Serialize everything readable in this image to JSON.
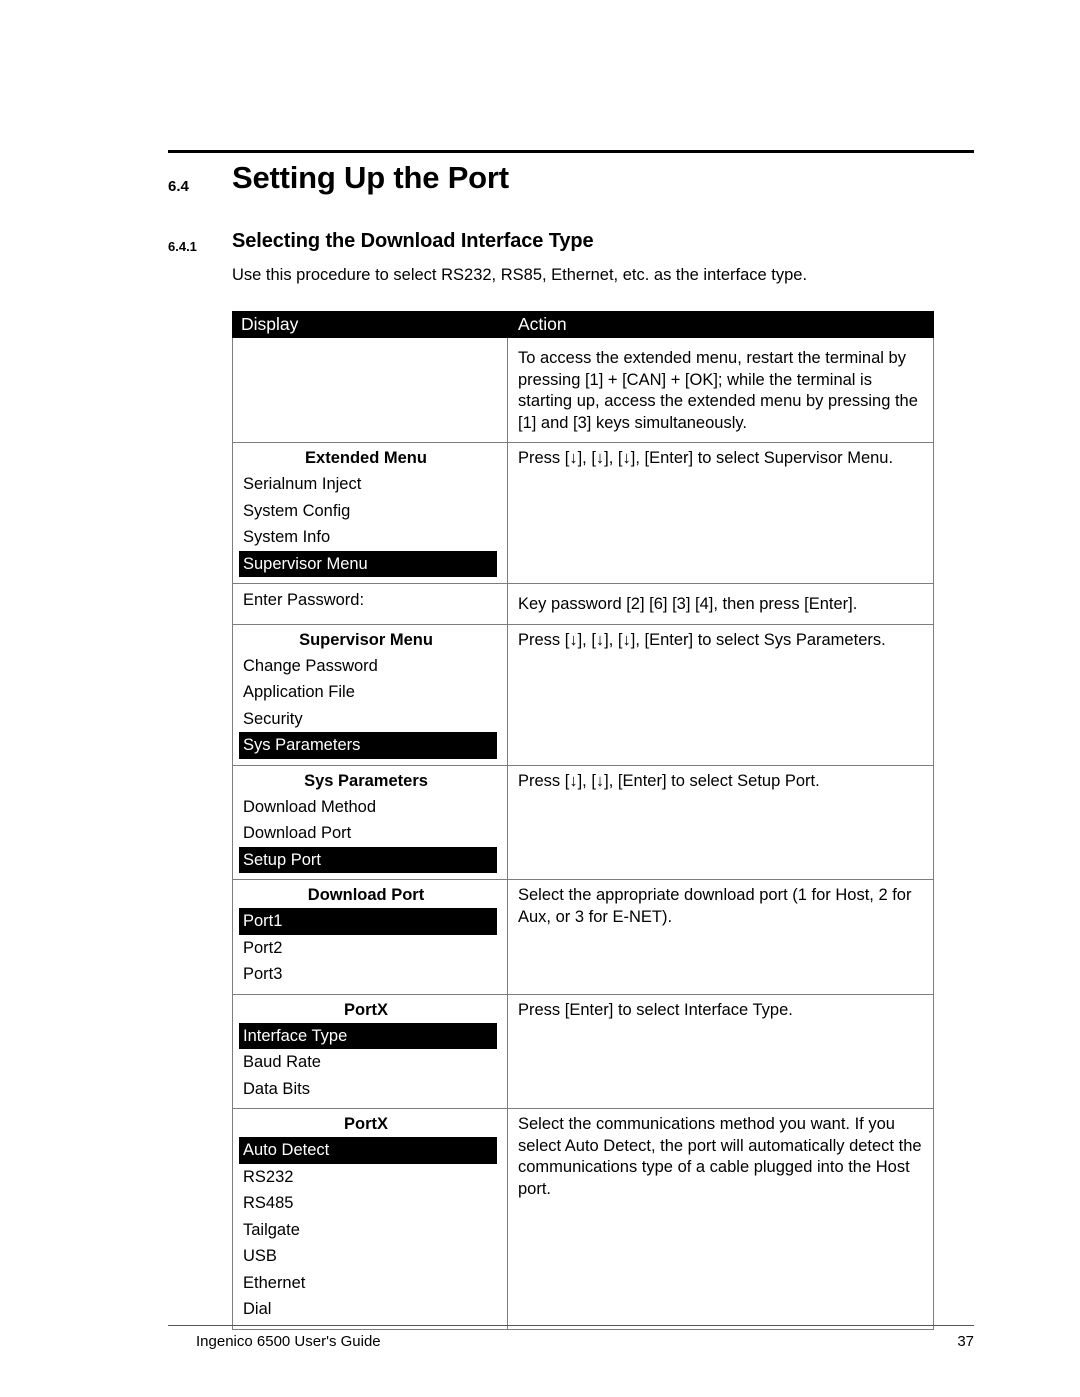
{
  "document": {
    "section_number": "6.4",
    "section_title": "Setting Up the Port",
    "subsection_number": "6.4.1",
    "subsection_title": "Selecting the Download Interface Type",
    "intro_text": "Use this procedure to select RS232, RS85, Ethernet, etc. as the interface type."
  },
  "table": {
    "headers": {
      "display": "Display",
      "action": "Action"
    },
    "rows": [
      {
        "display": {
          "type": "empty"
        },
        "action": "To access the extended menu, restart the terminal by pressing [1] + [CAN] + [OK]; while the terminal is starting up, access the extended menu by pressing the [1] and [3] keys simultaneously."
      },
      {
        "display": {
          "type": "menu",
          "title": "Extended Menu",
          "items": [
            "Serialnum Inject",
            "System Config",
            "System Info",
            "Supervisor Menu"
          ],
          "selected": "Supervisor Menu"
        },
        "action": "Press [↓], [↓], [↓], [Enter] to select Supervisor Menu."
      },
      {
        "display": {
          "type": "plain",
          "text": "Enter Password:"
        },
        "action": "Key password [2] [6] [3] [4], then press [Enter]."
      },
      {
        "display": {
          "type": "menu",
          "title": "Supervisor Menu",
          "items": [
            "Change Password",
            "Application File",
            "Security",
            "Sys Parameters"
          ],
          "selected": "Sys Parameters"
        },
        "action": "Press [↓], [↓], [↓], [Enter] to select Sys Parameters."
      },
      {
        "display": {
          "type": "menu",
          "title": "Sys Parameters",
          "items": [
            "Download Method",
            "Download Port",
            "Setup Port"
          ],
          "selected": "Setup Port"
        },
        "action": "Press [↓], [↓], [Enter] to select Setup Port."
      },
      {
        "display": {
          "type": "menu",
          "title": "Download Port",
          "items": [
            "Port1",
            "Port2",
            "Port3"
          ],
          "selected": "Port1"
        },
        "action": "Select the appropriate download port (1 for Host, 2 for Aux, or 3 for E-NET)."
      },
      {
        "display": {
          "type": "menu",
          "title": "PortX",
          "items": [
            "Interface Type",
            "Baud Rate",
            "Data Bits"
          ],
          "selected": "Interface Type"
        },
        "action": "Press [Enter] to select Interface Type."
      },
      {
        "display": {
          "type": "menu",
          "title": "PortX",
          "items": [
            "Auto Detect",
            "RS232",
            "RS485",
            "Tailgate",
            "USB",
            "Ethernet",
            "Dial"
          ],
          "selected": "Auto Detect"
        },
        "action": "Select the communications method you want. If you select Auto Detect, the port will automatically detect the communications type of a cable plugged into the Host port."
      }
    ]
  },
  "footer": {
    "left_text": "Ingenico 6500 User's Guide",
    "page_number": "37"
  },
  "colors": {
    "header_bg": "#000000",
    "header_fg": "#ffffff",
    "highlight_bg": "#000000",
    "highlight_fg": "#ffffff",
    "border": "#7d7d7d",
    "text": "#000000"
  }
}
